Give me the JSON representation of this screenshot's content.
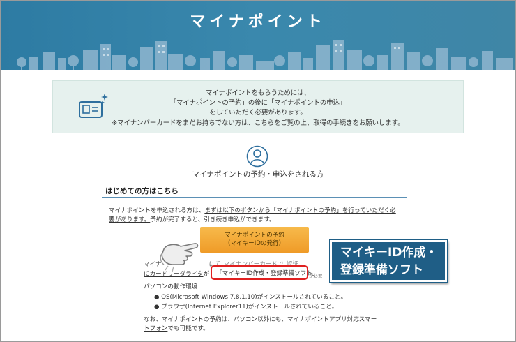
{
  "header": {
    "title": "マイナポイント"
  },
  "info": {
    "line1": "マイナポイントをもらうためには、",
    "line2": "「マイナポイントの予約」の後に「マイナポイントの申込」",
    "line3": "をしていただく必要があります。",
    "line4_pre": "※マイナンバーカードをまだお持ちでない方は、",
    "line4_link": "こちら",
    "line4_post": "をご覧の上、取得の手続きをお願いします。"
  },
  "section": {
    "title": "マイナポイントの予約・申込をされる方"
  },
  "subsection": {
    "title": "はじめての方はこちら"
  },
  "intro": {
    "line1_pre": "マイナポイントを申込される方は、",
    "line1_link": "まずは以下のボタンから「マイナポイントの予約」を行っていただく必",
    "line2_link": "要があります。",
    "line2_post": "予約が完了すると、引き続き申込ができます。"
  },
  "reserve_button": {
    "line1": "マイナポイントの予約",
    "line2": "（マイキーIDの発行）"
  },
  "pc_note": {
    "line1_a": "マイナ",
    "line1_b": "にて",
    "line1_c": "マイナンバーカード",
    "line1_d": "で",
    "line1_e": "認証",
    "line2_a": "ICカードリーダライタ",
    "line2_b": "が",
    "soft_link": "「マイキーID作成・登録準備ソフト」",
    "line2_tail": "が必要"
  },
  "env": {
    "heading": "パソコンの動作環境",
    "os": "OS(Microsoft Windows 7,8.1,10)がインストールされていること。",
    "browser": "ブラウザ(Internet Explorer11)がインストールされていること。"
  },
  "footer_note": {
    "line1_pre": "なお、マイナポイントの予約は、パソコン以外にも、",
    "line1_link": "マイナポイントアプリ対応スマー",
    "line2_link": "トフォン",
    "line2_post": "でも可能です。"
  },
  "callout": {
    "line1": "マイキーID作成・",
    "line2": "登録準備ソフト"
  },
  "colors": {
    "header_blue": "#3a88ad",
    "button_orange": "#f2a531",
    "callout_blue": "#1f5e86",
    "highlight_red": "#e02020"
  }
}
